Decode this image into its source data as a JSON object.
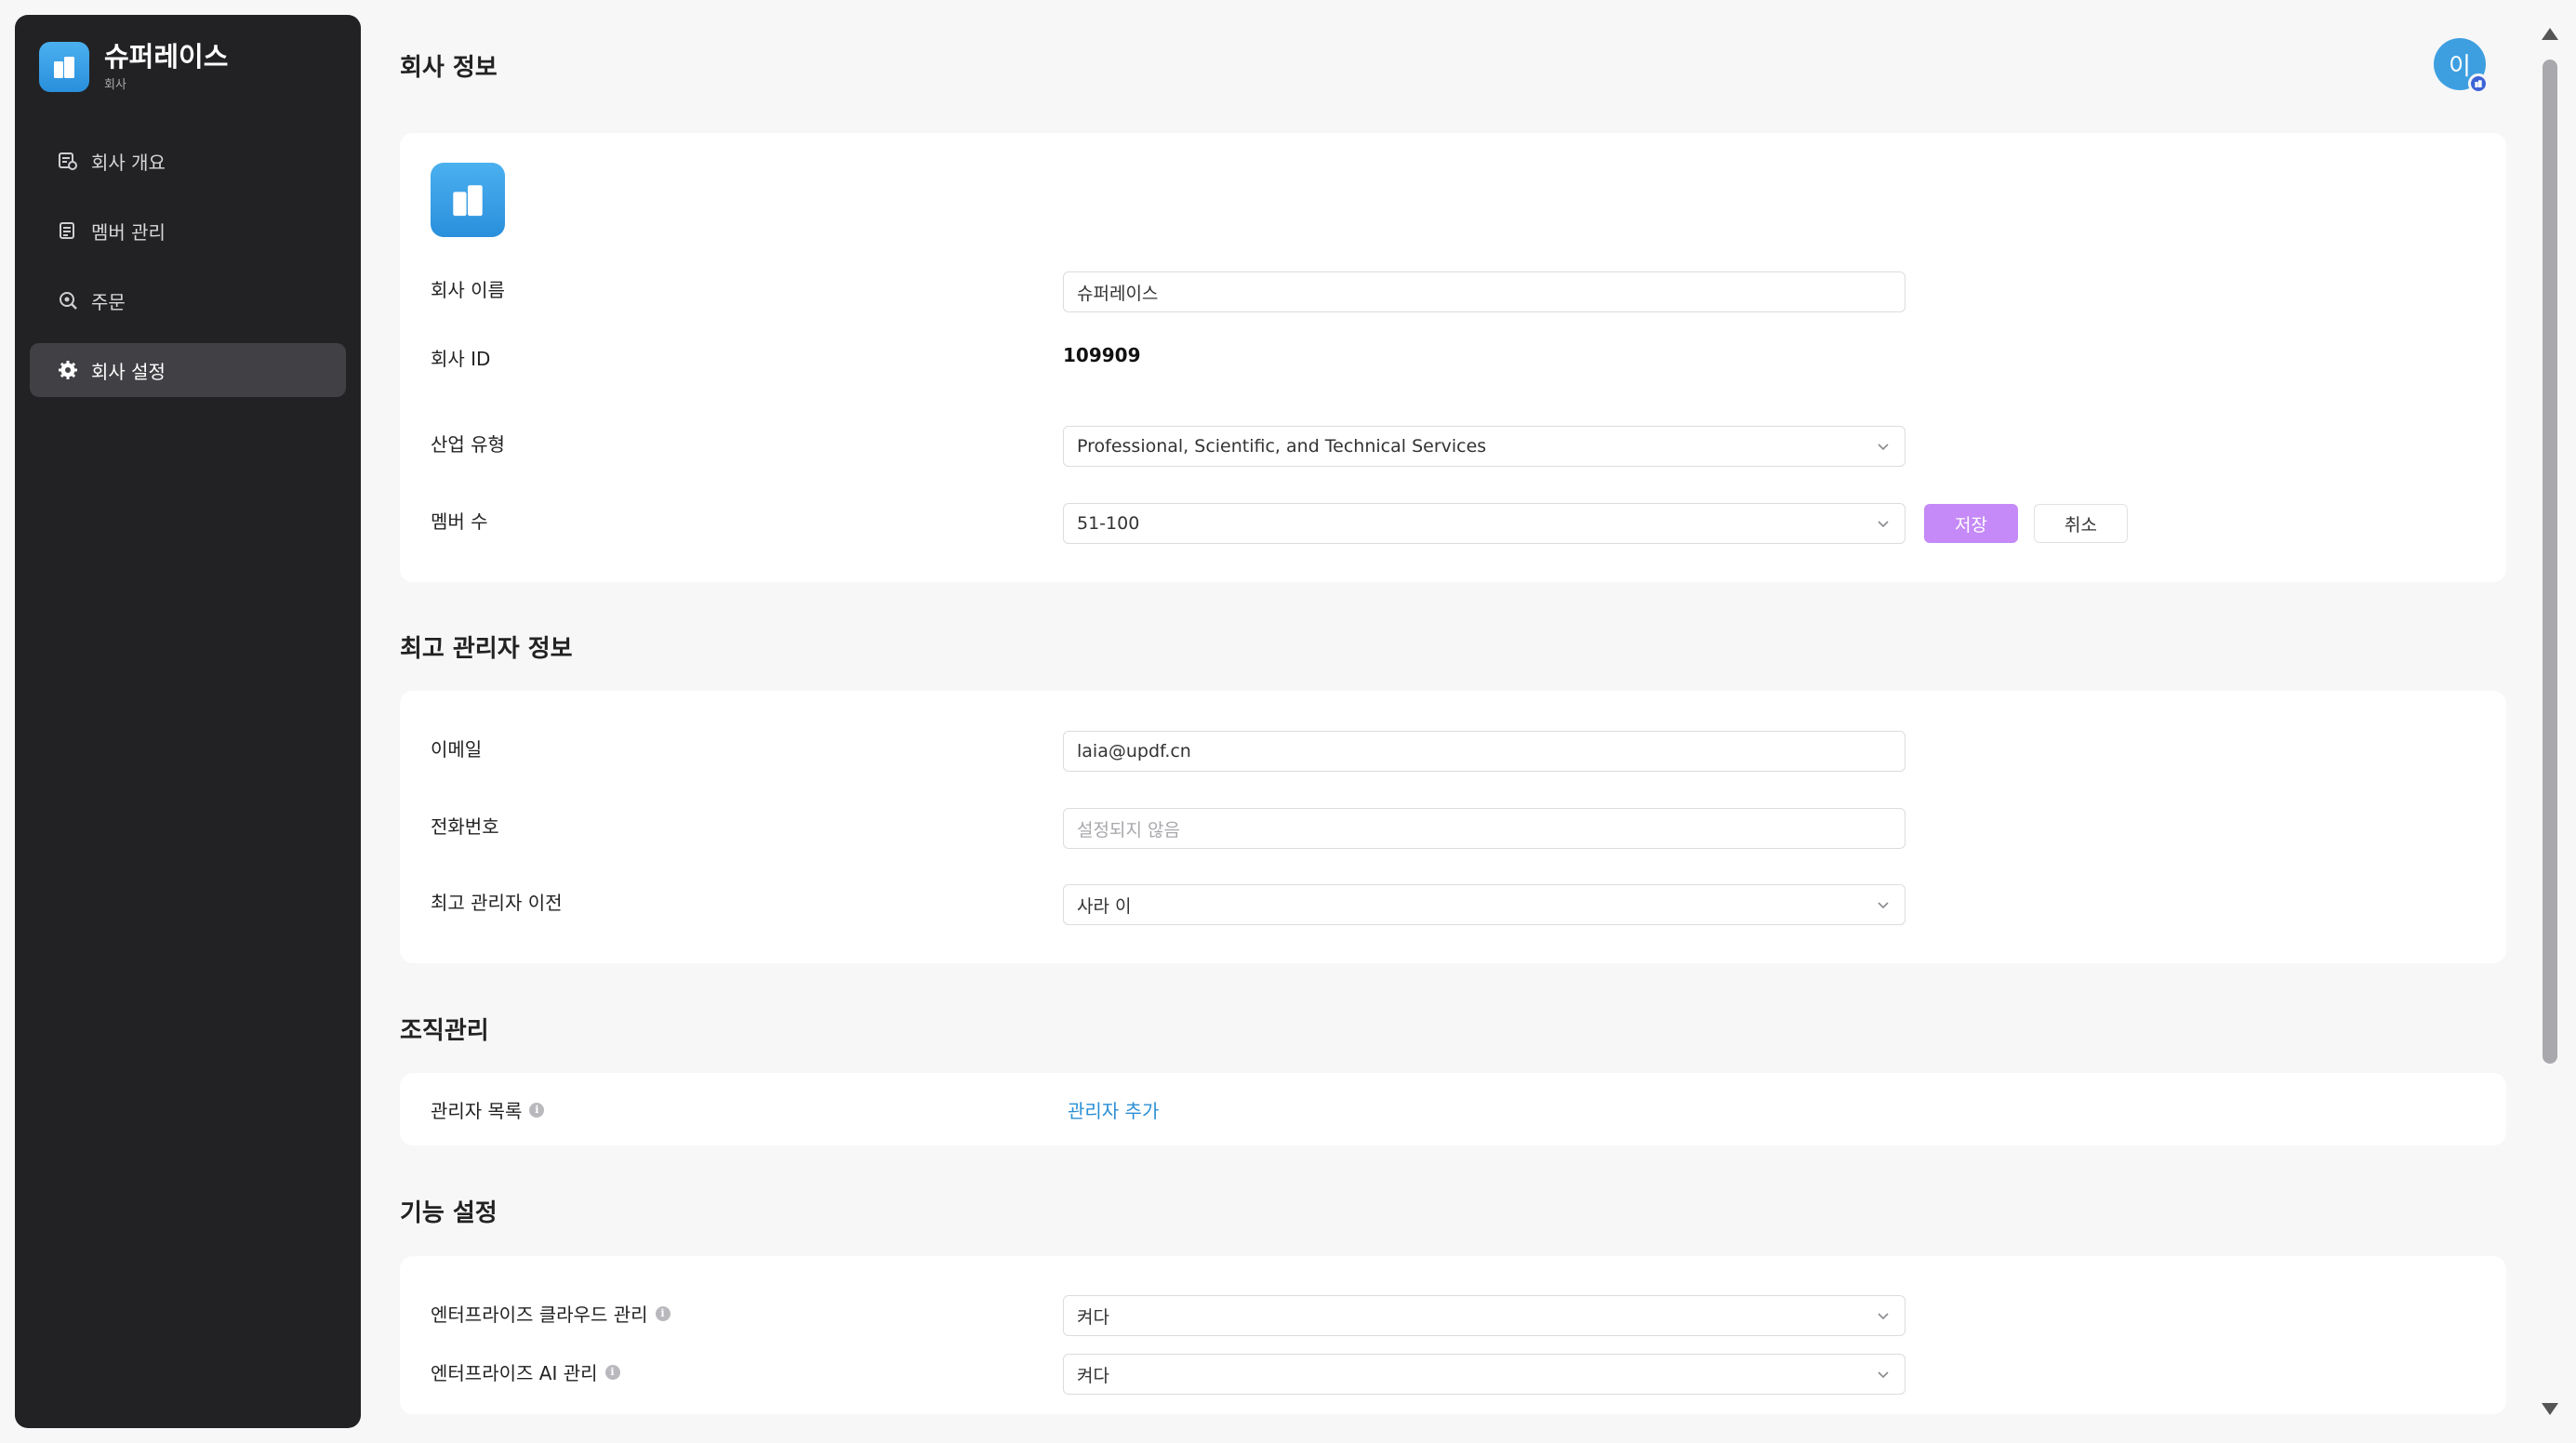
{
  "sidebar": {
    "brand_name": "슈퍼레이스",
    "brand_sub": "회사",
    "brand_color": "#2a8fdc",
    "items": [
      {
        "label": "회사 개요",
        "icon": "company-overview-icon",
        "active": false
      },
      {
        "label": "멤버 관리",
        "icon": "member-management-icon",
        "active": false
      },
      {
        "label": "주문",
        "icon": "order-search-icon",
        "active": false
      },
      {
        "label": "회사 설정",
        "icon": "gear-icon",
        "active": true
      }
    ]
  },
  "header": {
    "title": "회사 정보",
    "avatar_initial": "이"
  },
  "company": {
    "name_label": "회사 이름",
    "name_value": "슈퍼레이스",
    "id_label": "회사 ID",
    "id_value": "109909",
    "industry_label": "산업 유형",
    "industry_value": "Professional, Scientific, and Technical Services",
    "members_label": "멤버 수",
    "members_value": "51-100",
    "save_label": "저장",
    "cancel_label": "취소"
  },
  "super_admin": {
    "title": "최고 관리자 정보",
    "email_label": "이메일",
    "email_value": "laia@updf.cn",
    "phone_label": "전화번호",
    "phone_placeholder": "설정되지 않음",
    "transfer_label": "최고 관리자 이전",
    "transfer_value": "사라 이"
  },
  "organization": {
    "title": "조직관리",
    "admin_list_label": "관리자 목록",
    "add_admin_label": "관리자 추가"
  },
  "features": {
    "title": "기능 설정",
    "cloud_label": "엔터프라이즈 클라우드 관리",
    "cloud_value": "켜다",
    "ai_label": "엔터프라이즈 AI 관리",
    "ai_value": "켜다"
  },
  "colors": {
    "accent_purple": "#c58af7",
    "link_blue": "#2b8fd6",
    "sidebar_bg": "#222224"
  }
}
